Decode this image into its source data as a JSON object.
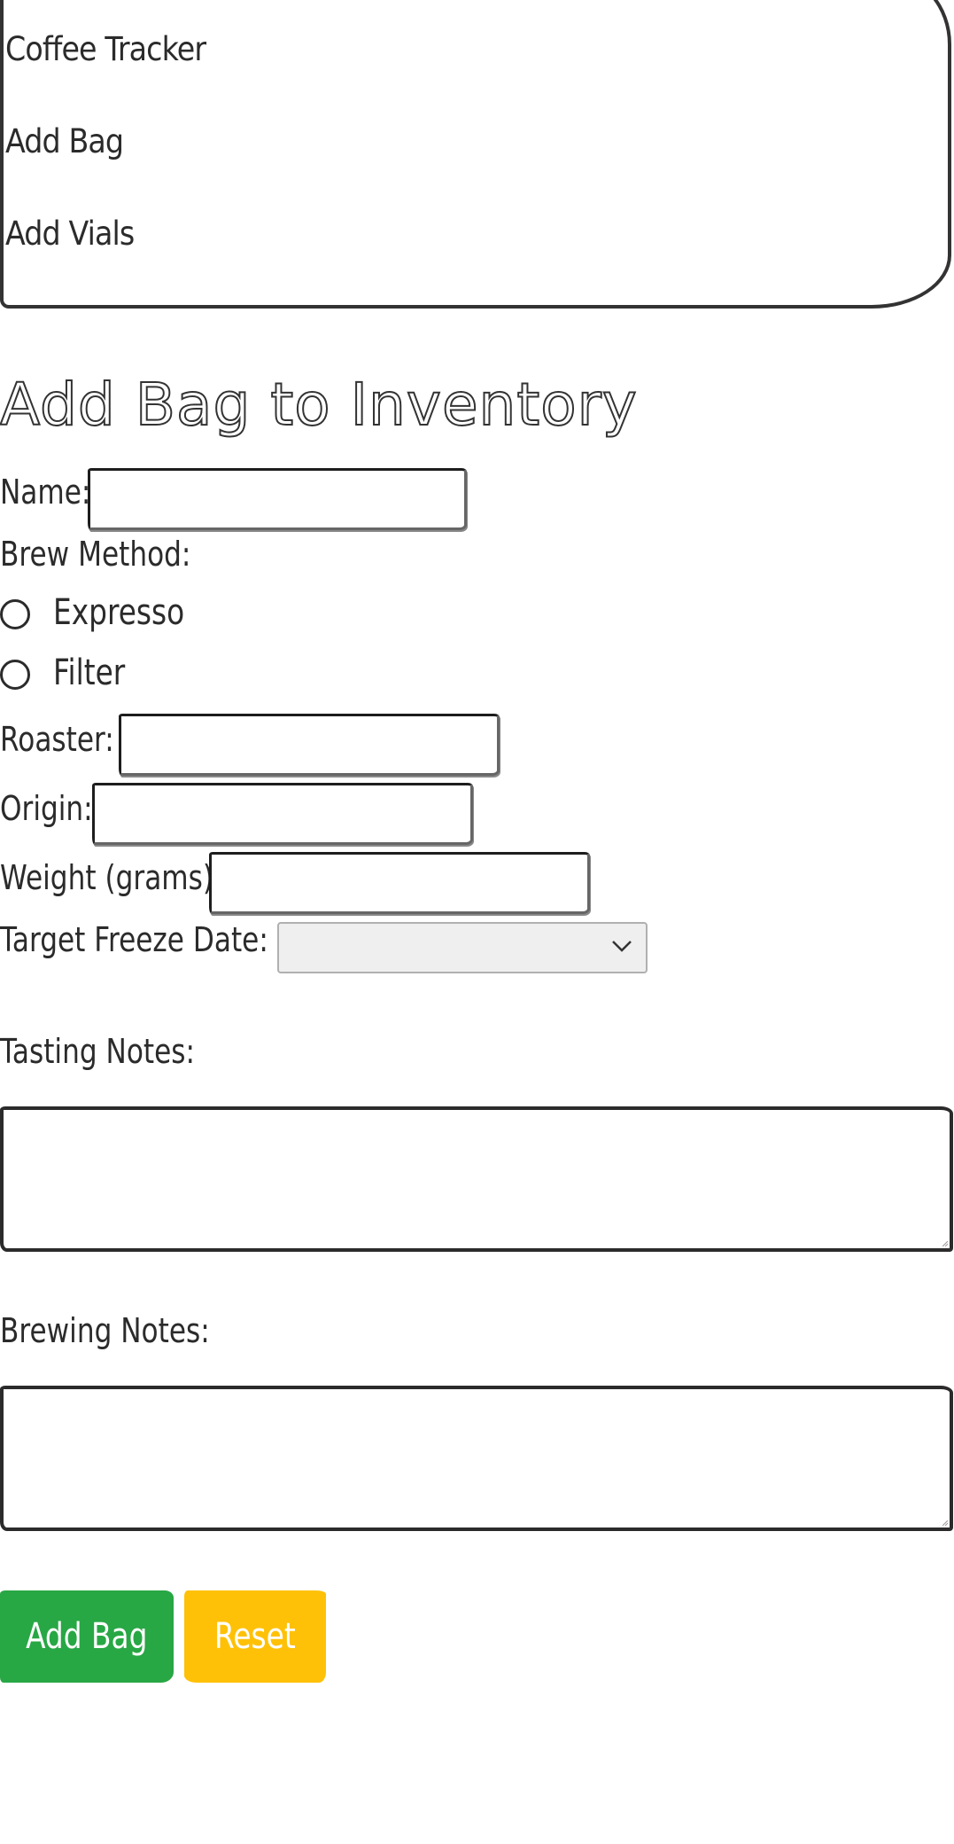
{
  "nav": {
    "brand": "Coffee Tracker",
    "items": [
      {
        "label": "Add Bag"
      },
      {
        "label": "Add Vials"
      }
    ]
  },
  "form": {
    "heading": "Add Bag to Inventory",
    "name_label": "Name:",
    "name_value": "",
    "brew_method_label": "Brew Method:",
    "brew_options": [
      {
        "label": "Expresso",
        "checked": false
      },
      {
        "label": "Filter",
        "checked": false
      }
    ],
    "roaster_label": "Roaster:",
    "roaster_value": "",
    "origin_label": "Origin:",
    "origin_value": "",
    "weight_label": "Weight (grams):",
    "weight_value": "",
    "freeze_date_label": "Target Freeze Date:",
    "freeze_date_selected": "",
    "tasting_notes_label": "Tasting Notes:",
    "tasting_notes_value": "",
    "brewing_notes_label": "Brewing Notes:",
    "brewing_notes_value": "",
    "submit_label": "Add Bag",
    "reset_label": "Reset"
  },
  "colors": {
    "submit": "#28a745",
    "reset": "#ffc107",
    "border": "#2b2b2b"
  }
}
